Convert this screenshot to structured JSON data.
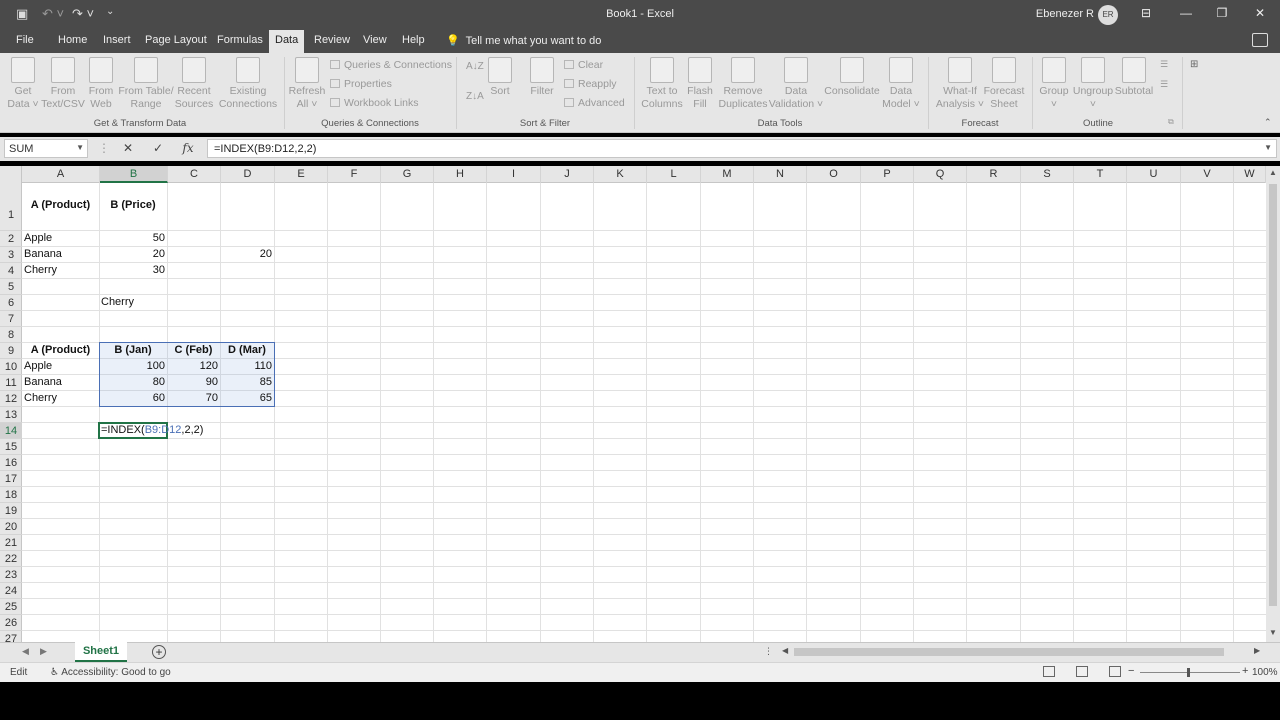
{
  "window": {
    "title": "Book1  -  Excel",
    "user_name": "Ebenezer R",
    "user_initials": "ER"
  },
  "tabs": [
    "File",
    "Home",
    "Insert",
    "Page Layout",
    "Formulas",
    "Data",
    "Review",
    "View",
    "Help"
  ],
  "active_tab": "Data",
  "tell_me": "Tell me what you want to do",
  "ribbon": {
    "get_data_l1": "Get",
    "get_data_l2": "Data ˅",
    "from_text_l1": "From",
    "from_text_l2": "Text/CSV",
    "from_web_l1": "From",
    "from_web_l2": "Web",
    "from_table_l1": "From Table/",
    "from_table_l2": "Range",
    "recent_l1": "Recent",
    "recent_l2": "Sources",
    "existing_l1": "Existing",
    "existing_l2": "Connections",
    "group_get": "Get & Transform Data",
    "refresh_l1": "Refresh",
    "refresh_l2": "All ˅",
    "queries": "Queries & Connections",
    "properties": "Properties",
    "workbook_links": "Workbook Links",
    "group_queries": "Queries & Connections",
    "sort": "Sort",
    "filter": "Filter",
    "clear": "Clear",
    "reapply": "Reapply",
    "advanced": "Advanced",
    "group_sort": "Sort & Filter",
    "text_to_cols_l1": "Text to",
    "text_to_cols_l2": "Columns",
    "flash_l1": "Flash",
    "flash_l2": "Fill",
    "remove_dup_l1": "Remove",
    "remove_dup_l2": "Duplicates",
    "data_val_l1": "Data",
    "data_val_l2": "Validation ˅",
    "consolidate": "Consolidate",
    "data_model_l1": "Data",
    "data_model_l2": "Model ˅",
    "group_tools": "Data Tools",
    "whatif_l1": "What-If",
    "whatif_l2": "Analysis ˅",
    "forecast_l1": "Forecast",
    "forecast_l2": "Sheet",
    "group_forecast": "Forecast",
    "group": "Group",
    "ungroup": "Ungroup",
    "subtotal": "Subtotal",
    "group_outline": "Outline"
  },
  "formula_bar": {
    "name_box": "SUM",
    "cancel": "✕",
    "enter": "✓",
    "fx": "fx",
    "formula": "=INDEX(B9:D12,2,2)"
  },
  "columns": [
    "A",
    "B",
    "C",
    "D",
    "E",
    "F",
    "G",
    "H",
    "I",
    "J",
    "K",
    "L",
    "M",
    "N",
    "O",
    "P",
    "Q",
    "R",
    "S",
    "T",
    "U",
    "V",
    "W"
  ],
  "rows": [
    "1",
    "2",
    "3",
    "4",
    "5",
    "6",
    "7",
    "8",
    "9",
    "10",
    "11",
    "12",
    "13",
    "14",
    "15",
    "16",
    "17",
    "18",
    "19",
    "20",
    "21",
    "22",
    "23",
    "24",
    "25",
    "26",
    "27"
  ],
  "sheet": {
    "a1": "A (Product)",
    "b1": "B (Price)",
    "a2": "Apple",
    "b2": "50",
    "a3": "Banana",
    "b3": "20",
    "d3": "20",
    "a4": "Cherry",
    "b4": "30",
    "b6": "Cherry",
    "a9": "A (Product)",
    "b9": "B (Jan)",
    "c9": "C (Feb)",
    "d9": "D (Mar)",
    "a10": "Apple",
    "b10": "100",
    "c10": "120",
    "d10": "110",
    "a11": "Banana",
    "b11": "80",
    "c11": "90",
    "d11": "85",
    "a12": "Cherry",
    "b12": "60",
    "c12": "70",
    "d12": "65",
    "b14_a": "=INDEX(",
    "b14_ref": "B9:D12",
    "b14_b": ",2,2)"
  },
  "sheet_tab": "Sheet1",
  "add_sheet": "+",
  "status": {
    "mode": "Edit",
    "accessibility": "Accessibility: Good to go",
    "zoom": "100%"
  }
}
